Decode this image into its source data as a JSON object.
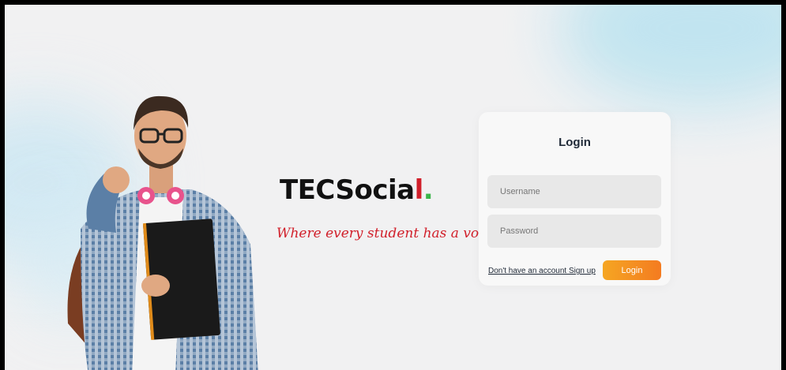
{
  "brand": {
    "name": "TECSocia",
    "name_end": "l",
    "dot": ".",
    "tagline": "Where every student has a voice!"
  },
  "login": {
    "title": "Login",
    "username_placeholder": "Username",
    "password_placeholder": "Password",
    "signup_link": "Don't have an account Sign up",
    "login_button": "Login"
  },
  "colors": {
    "accent_from": "#f5a623",
    "accent_to": "#f47b20",
    "tagline": "#d11f2a",
    "brand_dot": "#3bb54a"
  }
}
